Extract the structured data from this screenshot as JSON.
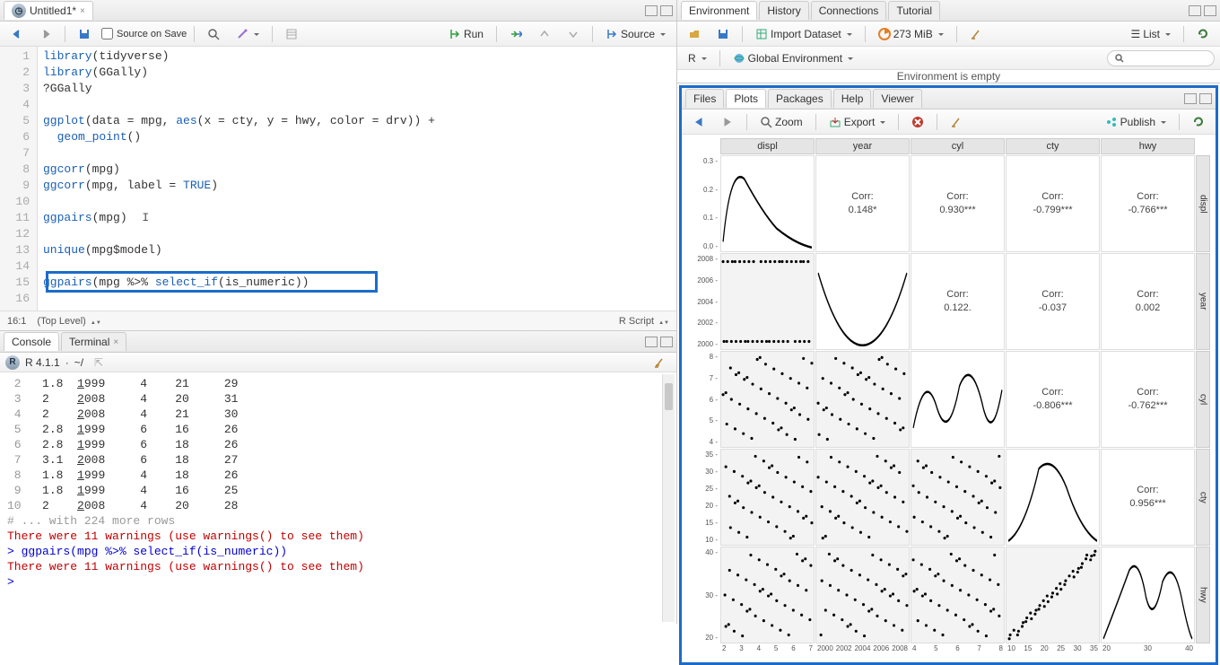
{
  "source": {
    "tab_title": "Untitled1*",
    "save_on_source": "Source on Save",
    "run_label": "Run",
    "source_label": "Source",
    "lines": [
      "library(tidyverse)",
      "library(GGally)",
      "?GGally",
      "",
      "ggplot(data = mpg, aes(x = cty, y = hwy, color = drv)) +",
      "  geom_point()",
      "",
      "ggcorr(mpg)",
      "ggcorr(mpg, label = TRUE)",
      "",
      "ggpairs(mpg)",
      "",
      "unique(mpg$model)",
      "",
      "ggpairs(mpg %>% select_if(is_numeric))",
      ""
    ],
    "cursor_pos": "16:1",
    "scope": "(Top Level)",
    "lang": "R Script"
  },
  "console": {
    "tab_console": "Console",
    "tab_terminal": "Terminal",
    "version": "R 4.1.1",
    "cwd": "~/",
    "rows": [
      {
        "n": "2",
        "vals": [
          "1.8",
          "1999",
          "4",
          "21",
          "29"
        ]
      },
      {
        "n": "3",
        "vals": [
          "2  ",
          "2008",
          "4",
          "20",
          "31"
        ]
      },
      {
        "n": "4",
        "vals": [
          "2  ",
          "2008",
          "4",
          "21",
          "30"
        ]
      },
      {
        "n": "5",
        "vals": [
          "2.8",
          "1999",
          "6",
          "16",
          "26"
        ]
      },
      {
        "n": "6",
        "vals": [
          "2.8",
          "1999",
          "6",
          "18",
          "26"
        ]
      },
      {
        "n": "7",
        "vals": [
          "3.1",
          "2008",
          "6",
          "18",
          "27"
        ]
      },
      {
        "n": "8",
        "vals": [
          "1.8",
          "1999",
          "4",
          "18",
          "26"
        ]
      },
      {
        "n": "9",
        "vals": [
          "1.8",
          "1999",
          "4",
          "16",
          "25"
        ]
      },
      {
        "n": "10",
        "vals": [
          "2  ",
          "2008",
          "4",
          "20",
          "28"
        ]
      }
    ],
    "more_rows": "# ... with 224 more rows",
    "warn1": "There were 11 warnings (use warnings() to see them)",
    "cmd": "> ggpairs(mpg %>% select_if(is_numeric))",
    "warn2": "There were 11 warnings (use warnings() to see them)",
    "prompt": "> "
  },
  "env": {
    "tabs": [
      "Environment",
      "History",
      "Connections",
      "Tutorial"
    ],
    "import": "Import Dataset",
    "mem": "273 MiB",
    "list": "List",
    "scope_r": "R",
    "scope_global": "Global Environment",
    "empty": "Environment is empty",
    "search_ph": ""
  },
  "plots": {
    "tabs": [
      "Files",
      "Plots",
      "Packages",
      "Help",
      "Viewer"
    ],
    "zoom": "Zoom",
    "export": "Export",
    "publish": "Publish"
  },
  "chart_data": {
    "type": "pairs-matrix",
    "variables": [
      "displ",
      "year",
      "cyl",
      "cty",
      "hwy"
    ],
    "y_ticks": {
      "displ": [
        "0.3",
        "0.2",
        "0.1",
        "0.0"
      ],
      "year": [
        "2008",
        "2006",
        "2004",
        "2002",
        "2000"
      ],
      "cyl": [
        "8",
        "7",
        "6",
        "5",
        "4"
      ],
      "cty": [
        "35",
        "30",
        "25",
        "20",
        "15",
        "10"
      ],
      "hwy": [
        "40",
        "30",
        "20"
      ]
    },
    "x_ticks": {
      "displ": [
        "2",
        "3",
        "4",
        "5",
        "6",
        "7"
      ],
      "year": [
        "2000",
        "2002",
        "2004",
        "2006",
        "2008"
      ],
      "cyl": [
        "4",
        "5",
        "6",
        "7",
        "8"
      ],
      "cty": [
        "10",
        "15",
        "20",
        "25",
        "30",
        "35"
      ],
      "hwy": [
        "20",
        "30",
        "40"
      ]
    },
    "correlations": {
      "displ_year": {
        "label": "Corr:",
        "value": "0.148*"
      },
      "displ_cyl": {
        "label": "Corr:",
        "value": "0.930***"
      },
      "displ_cty": {
        "label": "Corr:",
        "value": "-0.799***"
      },
      "displ_hwy": {
        "label": "Corr:",
        "value": "-0.766***"
      },
      "year_cyl": {
        "label": "Corr:",
        "value": "0.122."
      },
      "year_cty": {
        "label": "Corr:",
        "value": "-0.037"
      },
      "year_hwy": {
        "label": "Corr:",
        "value": "0.002"
      },
      "cyl_cty": {
        "label": "Corr:",
        "value": "-0.806***"
      },
      "cyl_hwy": {
        "label": "Corr:",
        "value": "-0.762***"
      },
      "cty_hwy": {
        "label": "Corr:",
        "value": "0.956***"
      }
    }
  }
}
